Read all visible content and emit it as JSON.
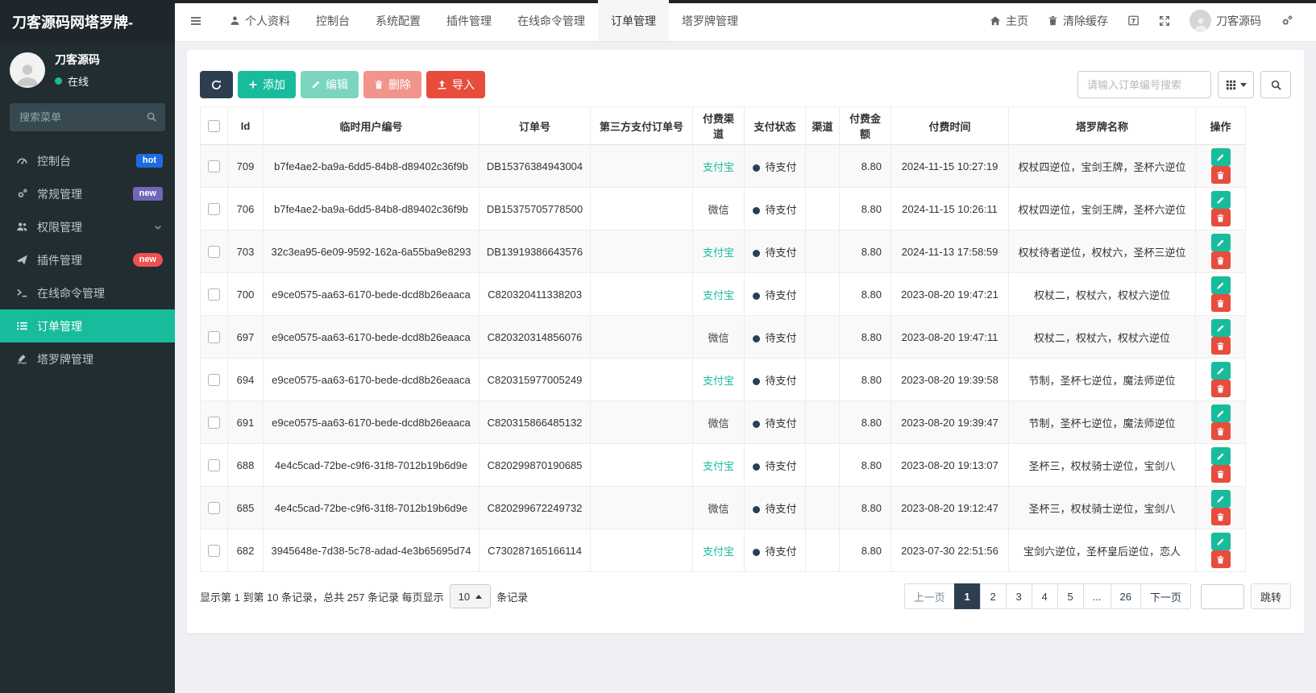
{
  "theme": {
    "teal": "#18bc9c",
    "red": "#e74c3c",
    "dark_navy": "#2c3e50",
    "sidebar_bg": "#222d32",
    "badge_blue": "#1d6ae5",
    "badge_purple": "#7266ba",
    "badge_red": "#f05050"
  },
  "sidebar": {
    "brand": "刀客源码网塔罗牌-",
    "user": {
      "name": "刀客源码",
      "status": "在线"
    },
    "search_placeholder": "搜索菜单",
    "items": [
      {
        "key": "console",
        "label": "控制台",
        "icon": "dashboard-icon",
        "badge": "hot",
        "badge_style": "blue"
      },
      {
        "key": "general",
        "label": "常规管理",
        "icon": "gears-icon",
        "badge": "new",
        "badge_style": "purple"
      },
      {
        "key": "permissions",
        "label": "权限管理",
        "icon": "users-icon",
        "chevron": true
      },
      {
        "key": "plugins",
        "label": "插件管理",
        "icon": "send-icon",
        "badge": "new",
        "badge_style": "red-pill"
      },
      {
        "key": "commands",
        "label": "在线命令管理",
        "icon": "terminal-icon"
      },
      {
        "key": "orders",
        "label": "订单管理",
        "icon": "list-icon",
        "active": true
      },
      {
        "key": "tarot",
        "label": "塔罗牌管理",
        "icon": "pen-icon"
      }
    ]
  },
  "navbar": {
    "menu": [
      {
        "key": "profile",
        "label": "个人资料",
        "icon": "user-icon"
      },
      {
        "key": "console",
        "label": "控制台"
      },
      {
        "key": "system-config",
        "label": "系统配置"
      },
      {
        "key": "plugins",
        "label": "插件管理"
      },
      {
        "key": "commands",
        "label": "在线命令管理"
      },
      {
        "key": "orders",
        "label": "订单管理",
        "active": true
      },
      {
        "key": "tarot",
        "label": "塔罗牌管理"
      }
    ],
    "home_label": "主页",
    "clear_cache_label": "清除缓存",
    "username": "刀客源码"
  },
  "toolbar": {
    "add_label": "添加",
    "edit_label": "编辑",
    "delete_label": "删除",
    "import_label": "导入",
    "search_placeholder": "请输入订单编号搜索"
  },
  "table": {
    "columns": [
      "Id",
      "临时用户编号",
      "订单号",
      "第三方支付订单号",
      "付费渠道",
      "支付状态",
      "渠道",
      "付费金额",
      "付费时间",
      "塔罗牌名称",
      "操作"
    ],
    "rows": [
      {
        "id": "709",
        "user_id": "b7fe4ae2-ba9a-6dd5-84b8-d89402c36f9b",
        "order_no": "DB15376384943004",
        "third_party_no": "",
        "channel": "支付宝",
        "channel_color": "#18bc9c",
        "status": "待支付",
        "sub_channel": "",
        "amount": "8.80",
        "pay_time": "2024-11-15 10:27:19",
        "tarot_names": "权杖四逆位，宝剑王牌，圣杯六逆位"
      },
      {
        "id": "706",
        "user_id": "b7fe4ae2-ba9a-6dd5-84b8-d89402c36f9b",
        "order_no": "DB15375705778500",
        "third_party_no": "",
        "channel": "微信",
        "channel_color": "#444444",
        "status": "待支付",
        "sub_channel": "",
        "amount": "8.80",
        "pay_time": "2024-11-15 10:26:11",
        "tarot_names": "权杖四逆位，宝剑王牌，圣杯六逆位"
      },
      {
        "id": "703",
        "user_id": "32c3ea95-6e09-9592-162a-6a55ba9e8293",
        "order_no": "DB13919386643576",
        "third_party_no": "",
        "channel": "支付宝",
        "channel_color": "#18bc9c",
        "status": "待支付",
        "sub_channel": "",
        "amount": "8.80",
        "pay_time": "2024-11-13 17:58:59",
        "tarot_names": "权杖待者逆位，权杖六，圣杯三逆位"
      },
      {
        "id": "700",
        "user_id": "e9ce0575-aa63-6170-bede-dcd8b26eaaca",
        "order_no": "C820320411338203",
        "third_party_no": "",
        "channel": "支付宝",
        "channel_color": "#18bc9c",
        "status": "待支付",
        "sub_channel": "",
        "amount": "8.80",
        "pay_time": "2023-08-20 19:47:21",
        "tarot_names": "权杖二，权杖六，权杖六逆位"
      },
      {
        "id": "697",
        "user_id": "e9ce0575-aa63-6170-bede-dcd8b26eaaca",
        "order_no": "C820320314856076",
        "third_party_no": "",
        "channel": "微信",
        "channel_color": "#444444",
        "status": "待支付",
        "sub_channel": "",
        "amount": "8.80",
        "pay_time": "2023-08-20 19:47:11",
        "tarot_names": "权杖二，权杖六，权杖六逆位"
      },
      {
        "id": "694",
        "user_id": "e9ce0575-aa63-6170-bede-dcd8b26eaaca",
        "order_no": "C820315977005249",
        "third_party_no": "",
        "channel": "支付宝",
        "channel_color": "#18bc9c",
        "status": "待支付",
        "sub_channel": "",
        "amount": "8.80",
        "pay_time": "2023-08-20 19:39:58",
        "tarot_names": "节制，圣杯七逆位，魔法师逆位"
      },
      {
        "id": "691",
        "user_id": "e9ce0575-aa63-6170-bede-dcd8b26eaaca",
        "order_no": "C820315866485132",
        "third_party_no": "",
        "channel": "微信",
        "channel_color": "#444444",
        "status": "待支付",
        "sub_channel": "",
        "amount": "8.80",
        "pay_time": "2023-08-20 19:39:47",
        "tarot_names": "节制，圣杯七逆位，魔法师逆位"
      },
      {
        "id": "688",
        "user_id": "4e4c5cad-72be-c9f6-31f8-7012b19b6d9e",
        "order_no": "C820299870190685",
        "third_party_no": "",
        "channel": "支付宝",
        "channel_color": "#18bc9c",
        "status": "待支付",
        "sub_channel": "",
        "amount": "8.80",
        "pay_time": "2023-08-20 19:13:07",
        "tarot_names": "圣杯三，权杖骑士逆位，宝剑八"
      },
      {
        "id": "685",
        "user_id": "4e4c5cad-72be-c9f6-31f8-7012b19b6d9e",
        "order_no": "C820299672249732",
        "third_party_no": "",
        "channel": "微信",
        "channel_color": "#444444",
        "status": "待支付",
        "sub_channel": "",
        "amount": "8.80",
        "pay_time": "2023-08-20 19:12:47",
        "tarot_names": "圣杯三，权杖骑士逆位，宝剑八"
      },
      {
        "id": "682",
        "user_id": "3945648e-7d38-5c78-adad-4e3b65695d74",
        "order_no": "C730287165166114",
        "third_party_no": "",
        "channel": "支付宝",
        "channel_color": "#18bc9c",
        "status": "待支付",
        "sub_channel": "",
        "amount": "8.80",
        "pay_time": "2023-07-30 22:51:56",
        "tarot_names": "宝剑六逆位，圣杯皇后逆位，恋人"
      }
    ]
  },
  "pagination": {
    "summary_prefix": "显示第 1 到第 10 条记录，总共 257 条记录 每页显示",
    "page_size": "10",
    "summary_suffix": "条记录",
    "prev_label": "上一页",
    "next_label": "下一页",
    "pages": [
      "1",
      "2",
      "3",
      "4",
      "5",
      "...",
      "26"
    ],
    "active_page": "1",
    "jump_label": "跳转"
  }
}
